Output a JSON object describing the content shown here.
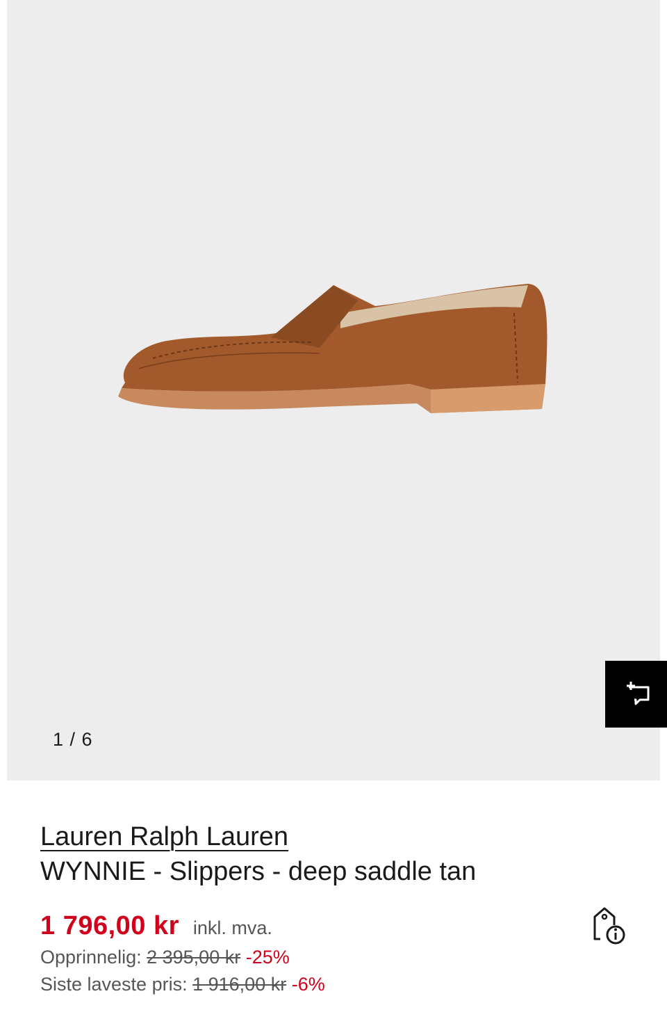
{
  "gallery": {
    "counter": "1 / 6",
    "background_color": "#ededed",
    "similar_icon": "crop-sparkle-icon"
  },
  "product": {
    "brand": "Lauren Ralph Lauren",
    "name": "WYNNIE - Slippers - deep saddle tan"
  },
  "pricing": {
    "price": "1 796,00 kr",
    "vat_note": "inkl. mva.",
    "original_label": "Opprinnelig:",
    "original_price": "2 395,00 kr",
    "original_discount": "-25%",
    "lowest_label": "Siste laveste pris:",
    "lowest_price": "1 916,00 kr",
    "lowest_discount": "-6%",
    "accent_color": "#d0021b",
    "info_icon": "price-tag-info-icon"
  }
}
